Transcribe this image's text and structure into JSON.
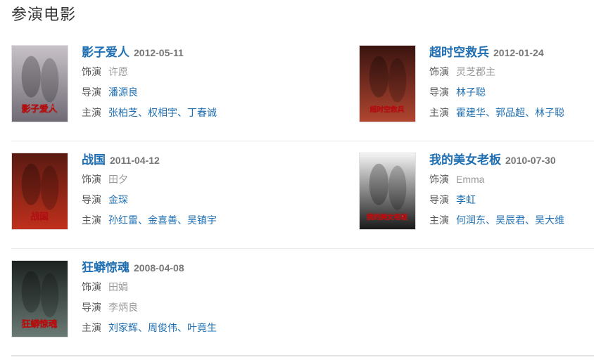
{
  "section_title": "参演电影",
  "labels": {
    "role": "饰演",
    "director": "导演",
    "cast": "主演"
  },
  "sep": "、",
  "movies": [
    {
      "name": "影子爱人",
      "date": "2012-05-11",
      "role": "许愿",
      "director": [
        "潘源良"
      ],
      "cast": [
        "张柏芝",
        "权相宇",
        "丁春诚"
      ],
      "poster_text": "影子爱人",
      "poster_colors": [
        "#c8c2c8",
        "#6f6a74"
      ]
    },
    {
      "name": "超时空救兵",
      "date": "2012-01-24",
      "role": "灵芝郡主",
      "director": [
        "林子聪"
      ],
      "cast": [
        "霍建华",
        "郭品超",
        "林子聪"
      ],
      "poster_text": "超时空救兵",
      "poster_colors": [
        "#3a1410",
        "#b04530"
      ]
    },
    {
      "name": "战国",
      "date": "2011-04-12",
      "role": "田夕",
      "director": [
        "金琛"
      ],
      "cast": [
        "孙红雷",
        "金喜善",
        "吴镇宇"
      ],
      "poster_text": "战国",
      "poster_colors": [
        "#5a1a12",
        "#c0301c"
      ]
    },
    {
      "name": "我的美女老板",
      "date": "2010-07-30",
      "role": "Emma",
      "director": [
        "李虹"
      ],
      "cast": [
        "何润东",
        "吴辰君",
        "吴大维"
      ],
      "poster_text": "我的美女老板",
      "poster_colors": [
        "#f4f4f4",
        "#1a1a1a"
      ]
    },
    {
      "name": "狂蟒惊魂",
      "date": "2008-04-08",
      "role": "田娟",
      "director": "李炳良",
      "cast": [
        "刘家辉",
        "周俊伟",
        "叶竟生"
      ],
      "poster_text": "狂蟒惊魂",
      "poster_colors": [
        "#1c2220",
        "#6a7a74"
      ]
    }
  ]
}
